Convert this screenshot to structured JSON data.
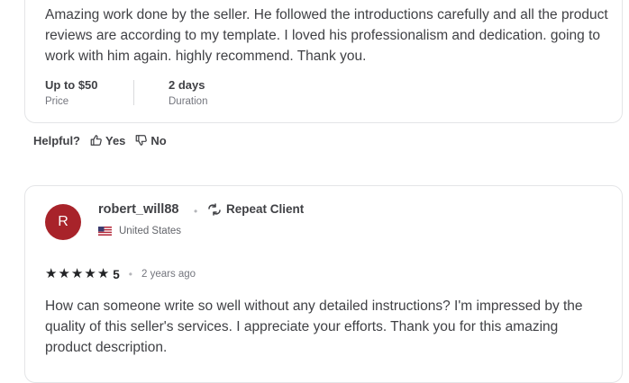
{
  "review1": {
    "text": "Amazing work done by the seller. He followed the introductions carefully and all the product reviews are according to my template. I loved his professionalism and dedication. going to work with him again. highly recommend. Thank you.",
    "price_value": "Up to $50",
    "price_label": "Price",
    "duration_value": "2 days",
    "duration_label": "Duration"
  },
  "helpful": {
    "label": "Helpful?",
    "yes": "Yes",
    "no": "No"
  },
  "review2": {
    "avatar_initial": "R",
    "avatar_color": "#a8232a",
    "username": "robert_will88",
    "repeat_label": "Repeat Client",
    "country": "United States",
    "rating_value": "5",
    "stars": 5,
    "time_ago": "2 years ago",
    "text": "How can someone write so well without any detailed instructions? I'm impressed by the quality of this seller's services. I appreciate your efforts. Thank you for this amazing product description."
  }
}
